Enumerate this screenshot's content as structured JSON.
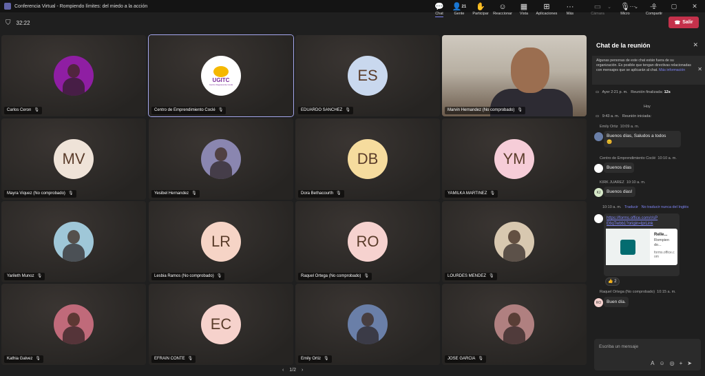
{
  "window": {
    "title": "Conferencia Virtual - Rompiendo límites: del miedo a la acción"
  },
  "meeting": {
    "timer": "32:22"
  },
  "toolbar": {
    "chat": "Chat",
    "people": "Gente",
    "people_count": "21",
    "raise": "Participar",
    "react": "Reaccionar",
    "view": "Vista",
    "apps": "Aplicaciones",
    "more": "Más",
    "camera": "Cámara",
    "mic": "Micro",
    "share": "Compartir",
    "leave": "Salir"
  },
  "participants": [
    {
      "name": "Carlos Ceron",
      "type": "photo",
      "initials": "",
      "bg": "#8f1ea3"
    },
    {
      "name": "Centro de Emprendimiento Coclé",
      "type": "logo",
      "initials": "UGITC",
      "logo_sub": "Centro Regional de Coclé",
      "bg": "#ffffff"
    },
    {
      "name": "EDUARDO SANCHEZ",
      "type": "initials",
      "initials": "ES",
      "bg": "#c9d8ee"
    },
    {
      "name": "Marvin Hernandez (No comprobado)",
      "type": "video",
      "initials": "",
      "bg": "#6a5a4a"
    },
    {
      "name": "Mayra Viquez (No comprobado)",
      "type": "initials",
      "initials": "MV",
      "bg": "#efe3d8"
    },
    {
      "name": "Yesibel Hernandez",
      "type": "photo",
      "initials": "",
      "bg": "#8a86b0"
    },
    {
      "name": "Dora Bethacourth",
      "type": "initials",
      "initials": "DB",
      "bg": "#f6dc9e"
    },
    {
      "name": "YAMILKA MARTINEZ",
      "type": "initials",
      "initials": "YM",
      "bg": "#f6cdd8"
    },
    {
      "name": "Yarileth Munoz",
      "type": "photo",
      "initials": "",
      "bg": "#9fc7d8"
    },
    {
      "name": "Lesbia Ramos (No comprobado)",
      "type": "initials",
      "initials": "LR",
      "bg": "#f6d4c6"
    },
    {
      "name": "Raquel Ortega (No comprobado)",
      "type": "initials",
      "initials": "RO",
      "bg": "#f6d2cf"
    },
    {
      "name": "LOURDES MENDEZ",
      "type": "photo",
      "initials": "",
      "bg": "#d8c8b0"
    },
    {
      "name": "Kathia Galvez",
      "type": "photo",
      "initials": "",
      "bg": "#c06a7a"
    },
    {
      "name": "EFRAIN CONTE",
      "type": "initials",
      "initials": "EC",
      "bg": "#f6d2cc"
    },
    {
      "name": "Emily Ortiz",
      "type": "photo",
      "initials": "",
      "bg": "#6a7fa8"
    },
    {
      "name": "JOSE GARCIA",
      "type": "photo",
      "initials": "",
      "bg": "#b08080"
    }
  ],
  "pager": {
    "label": "1/2"
  },
  "chat": {
    "title": "Chat de la reunión",
    "notice": "Algunas personas de este chat están fuera de su organización. Es posible que tengan directivas relacionadas con mensajes que se aplicarán al chat.",
    "notice_link": "Más información",
    "event1_time": "Ayer 2:21 p. m.",
    "event1_text": "Reunión finalizada:",
    "event1_dur": "12s",
    "today": "Hoy",
    "event2_time": "9:43 a. m.",
    "event2_text": "Reunión iniciada:",
    "m1_sender": "Emily Ortiz",
    "m1_time": "10:09 a. m.",
    "m1_text": "Buenos días, Saludos a todos",
    "m2_sender": "Centro de Emprendimiento Coclé",
    "m2_time": "10:10 a. m.",
    "m2_text": "Buenos días",
    "m3_sender": "KIRK JUAREZ",
    "m3_time": "10:10 a. m.",
    "m3_text": "Buenos dias!",
    "m3_initials": "KJ",
    "m4_time": "10:10 a. m.",
    "m4_translate": "Traducir",
    "m4_notranslate": "No traducir nunca del Inglés",
    "m4_link": "https://forms.office.com/r/sPE6qTwbb1?origin=lprLink",
    "card_title": "Relle...",
    "card_desc": "Rompien do...",
    "card_domain": "forms.office.com",
    "reaction_count": "2",
    "m5_sender": "Raquel Ortega (No comprobado)",
    "m5_time": "10:15 a. m.",
    "m5_text": "Buen día.",
    "m5_initials": "RO",
    "compose_placeholder": "Escriba un mensaje"
  }
}
